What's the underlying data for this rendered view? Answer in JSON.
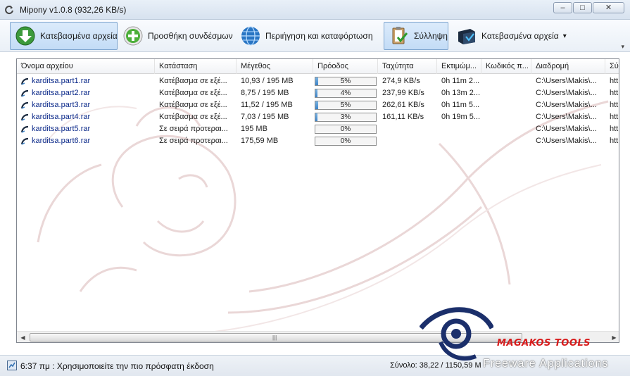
{
  "window": {
    "title": "Mipony v1.0.8 (932,26 KB/s)",
    "minimize": "–",
    "maximize": "□",
    "close": "✕"
  },
  "toolbar": {
    "items": [
      {
        "label": "Κατεβασμένα αρχεία",
        "icon": "download-arrow-icon"
      },
      {
        "label": "Προσθήκη συνδέσμων",
        "icon": "add-plus-icon"
      },
      {
        "label": "Περιήγηση και καταφόρτωση",
        "icon": "globe-icon"
      },
      {
        "label": "Σύλληψη",
        "icon": "clipboard-check-icon"
      },
      {
        "label": "Κατεβασμένα αρχεία",
        "icon": "downloaded-folder-icon",
        "dropdown": "▾"
      }
    ],
    "overflow_arrow": "▾"
  },
  "list": {
    "columns": [
      "Όνομα αρχείου",
      "Κατάσταση",
      "Μέγεθος",
      "Πρόοδος",
      "Ταχύτητα",
      "Εκτιμώμ...",
      "Κωδικός π...",
      "Διαδρομή",
      "Σύ"
    ],
    "rows": [
      {
        "name": "karditsa.part1.rar",
        "status": "Κατέβασμα σε εξέ...",
        "size": "10,93 / 195 MB",
        "progress": 5,
        "progress_text": "5%",
        "speed": "274,9 KB/s",
        "eta": "0h 11m 2...",
        "password": "",
        "path": "C:\\Users\\Makis\\...",
        "extra": "htt"
      },
      {
        "name": "karditsa.part2.rar",
        "status": "Κατέβασμα σε εξέ...",
        "size": "8,75 / 195 MB",
        "progress": 4,
        "progress_text": "4%",
        "speed": "237,99 KB/s",
        "eta": "0h 13m 2...",
        "password": "",
        "path": "C:\\Users\\Makis\\...",
        "extra": "htt"
      },
      {
        "name": "karditsa.part3.rar",
        "status": "Κατέβασμα σε εξέ...",
        "size": "11,52 / 195 MB",
        "progress": 5,
        "progress_text": "5%",
        "speed": "262,61 KB/s",
        "eta": "0h 11m 5...",
        "password": "",
        "path": "C:\\Users\\Makis\\...",
        "extra": "htt"
      },
      {
        "name": "karditsa.part4.rar",
        "status": "Κατέβασμα σε εξέ...",
        "size": "7,03 / 195 MB",
        "progress": 3,
        "progress_text": "3%",
        "speed": "161,11 KB/s",
        "eta": "0h 19m 5...",
        "password": "",
        "path": "C:\\Users\\Makis\\...",
        "extra": "htt"
      },
      {
        "name": "karditsa.part5.rar",
        "status": "Σε σειρά προτεραι...",
        "size": "195 MB",
        "progress": 0,
        "progress_text": "0%",
        "speed": "",
        "eta": "",
        "password": "",
        "path": "C:\\Users\\Makis\\...",
        "extra": "htt"
      },
      {
        "name": "karditsa.part6.rar",
        "status": "Σε σειρά προτεραι...",
        "size": "175,59 MB",
        "progress": 0,
        "progress_text": "0%",
        "speed": "",
        "eta": "",
        "password": "",
        "path": "C:\\Users\\Makis\\...",
        "extra": "htt"
      }
    ],
    "scroll_left": "◀",
    "scroll_right": "▶",
    "scroll_grip": "|||"
  },
  "status": {
    "message": "6:37 πμ : Χρησιμοποιείτε την πιο πρόσφατη έκδοση",
    "total": "Σύνολο: 38,22 / 1150,59 M"
  },
  "branding": {
    "logo_text": "MAGAKOS TOOLS",
    "sub_text": "Freeware Applications"
  },
  "colors": {
    "accent_blue": "#3c84c9",
    "file_link": "#0c2a8a",
    "brand_red": "#d81c1c",
    "brand_navy": "#1b2f6b"
  }
}
